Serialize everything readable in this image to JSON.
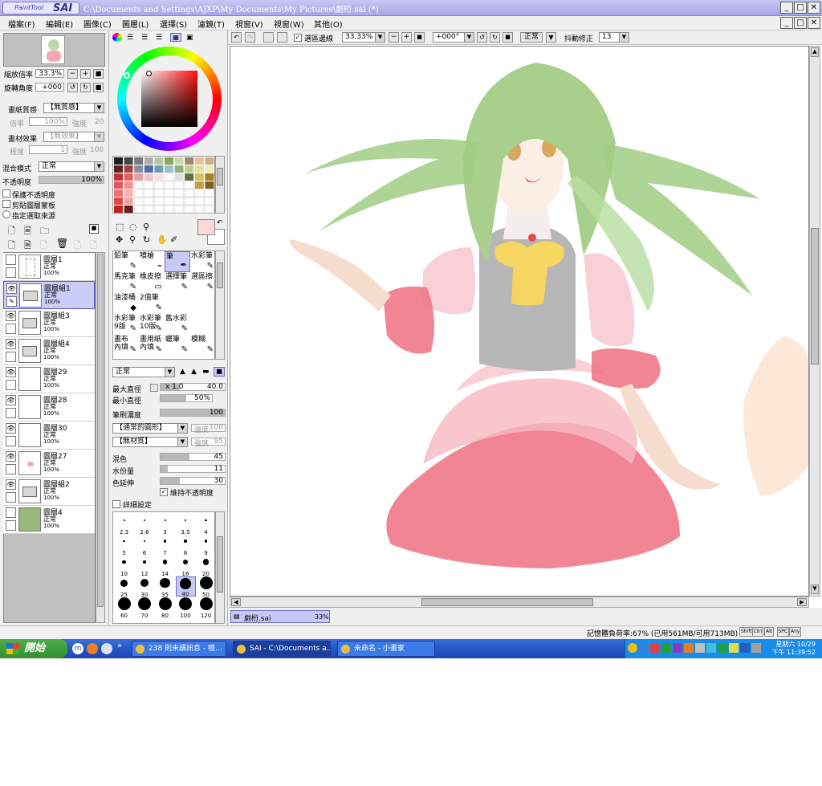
{
  "app": {
    "logo_small": "PaintTool",
    "logo_big": "SAI",
    "title": "C:\\Documents and Settings\\AJXP\\My Documents\\My Pictures\\劇桁.sai (*)",
    "win_min": "_",
    "win_max": "□",
    "win_close": "✕"
  },
  "menu": [
    "檔案(F)",
    "編輯(E)",
    "圖像(C)",
    "圖層(L)",
    "選擇(S)",
    "濾鏡(T)",
    "視窗(V)",
    "視窗(W)",
    "其他(O)"
  ],
  "navigator": {
    "zoom_label": "縮放倍率",
    "zoom_value": "33.3%",
    "rotate_label": "旋轉角度",
    "rotate_value": "+000"
  },
  "layer_props": {
    "paper_texture_label": "畫紙質感",
    "paper_texture_value": "【無質感】",
    "scale_label": "倍率",
    "scale_value": "100%",
    "strength_label": "強度",
    "strength_value": "20",
    "material_label": "畫材效果",
    "material_value": "【無效果】",
    "degree_label": "程度",
    "degree_value": "1",
    "strength2_label": "強度",
    "strength2_value": "100",
    "blend_label": "混合模式",
    "blend_value": "正常",
    "opacity_label": "不透明度",
    "opacity_value": "100%",
    "protect_opacity": "保護不透明度",
    "clip_group": "剪貼圖層蒙板",
    "selection_source": "指定選取來源"
  },
  "layers": [
    {
      "name": "圖層1",
      "mode": "正常",
      "opacity": "100%",
      "visible": false,
      "kind": "sketch"
    },
    {
      "name": "圖層組1",
      "mode": "正常",
      "opacity": "100%",
      "visible": true,
      "kind": "folder",
      "active": true
    },
    {
      "name": "圖層組3",
      "mode": "正常",
      "opacity": "100%",
      "visible": true,
      "kind": "folder"
    },
    {
      "name": "圖層組4",
      "mode": "正常",
      "opacity": "100%",
      "visible": true,
      "kind": "folder"
    },
    {
      "name": "圖層29",
      "mode": "正常",
      "opacity": "100%",
      "visible": true,
      "kind": "blank"
    },
    {
      "name": "圖層28",
      "mode": "正常",
      "opacity": "100%",
      "visible": true,
      "kind": "blank"
    },
    {
      "name": "圖層30",
      "mode": "正常",
      "opacity": "100%",
      "visible": true,
      "kind": "blank"
    },
    {
      "name": "圖層27",
      "mode": "正常",
      "opacity": "100%",
      "visible": true,
      "kind": "pink"
    },
    {
      "name": "圖層組2",
      "mode": "正常",
      "opacity": "100%",
      "visible": true,
      "kind": "folder"
    },
    {
      "name": "圖層4",
      "mode": "正常",
      "opacity": "100%",
      "visible": false,
      "kind": "green"
    }
  ],
  "tools": [
    {
      "label": "鉛筆",
      "icon": "✎"
    },
    {
      "label": "噴槍",
      "icon": "⌁"
    },
    {
      "label": "筆",
      "icon": "✒",
      "active": true
    },
    {
      "label": "水彩筆",
      "icon": "✎"
    },
    {
      "label": "馬克筆",
      "icon": "✎"
    },
    {
      "label": "橡皮擦",
      "icon": "▭"
    },
    {
      "label": "選擇筆",
      "icon": "✎"
    },
    {
      "label": "選區擦",
      "icon": "✎"
    },
    {
      "label": "油漆桶",
      "icon": "◆"
    },
    {
      "label": "2值筆",
      "icon": "✎"
    },
    {
      "label": "",
      "icon": ""
    },
    {
      "label": "",
      "icon": ""
    },
    {
      "label": "水彩筆 9版",
      "icon": "✎"
    },
    {
      "label": "水彩筆 10版",
      "icon": "✎"
    },
    {
      "label": "舊水彩",
      "icon": "✎"
    },
    {
      "label": "",
      "icon": ""
    },
    {
      "label": "畫布 內填",
      "icon": "✎"
    },
    {
      "label": "畫用紙 內填",
      "icon": "✎"
    },
    {
      "label": "蠟筆",
      "icon": "✎"
    },
    {
      "label": "模糊",
      "icon": "✎"
    }
  ],
  "brush": {
    "mode": "正常",
    "max_diam_label": "最大直徑",
    "max_diam_mult": "x 1.0",
    "max_diam_value": "40.0",
    "min_diam_label": "最小直徑",
    "min_diam_value": "50%",
    "density_label": "筆刷濃度",
    "density_value": "100",
    "shape_value": "【通常的圓形】",
    "shape_strength_label": "強度",
    "shape_strength_value": "100",
    "texture_value": "【無材質】",
    "texture_strength_label": "強度",
    "texture_strength_value": "95",
    "blend_label": "混色",
    "blend_value": "45",
    "water_label": "水份量",
    "water_value": "11",
    "color_ext_label": "色延伸",
    "color_ext_value": "30",
    "keep_opacity": "維持不透明度",
    "detail_settings": "詳細設定"
  },
  "brush_sizes": [
    "2.3",
    "2.6",
    "3",
    "3.5",
    "4",
    "5",
    "6",
    "7",
    "8",
    "9",
    "10",
    "12",
    "14",
    "16",
    "20",
    "25",
    "30",
    "35",
    "40",
    "50",
    "60",
    "70",
    "80",
    "100",
    "120"
  ],
  "brush_size_active": "40",
  "canvas_toolbar": {
    "selection_edge": "選區邊線",
    "zoom": "33.33%",
    "rotation": "+000°",
    "mode": "正常",
    "stabilizer_label": "抖動修正",
    "stabilizer_value": "13"
  },
  "doc_tab": {
    "name": "劇桁.sai",
    "zoom": "33%"
  },
  "status": {
    "memory": "記憶體負荷率:67% (已用561MB/可用713MB)",
    "keys": [
      "Shift",
      "Ctrl",
      "Alt",
      "SPC",
      "Any"
    ]
  },
  "taskbar": {
    "start": "開始",
    "tasks": [
      {
        "label": "238 則未讀訊息 - 噫...",
        "active": false
      },
      {
        "label": "SAI - C:\\Documents a...",
        "active": true
      },
      {
        "label": "未命名 - 小畫家",
        "active": false
      }
    ],
    "clock_day": "星期六 10/29",
    "clock_time": "下午 11:39:52"
  },
  "colors": {
    "accent": "#a9a5e8",
    "selection": "#ccccf8",
    "hair": "#a8d08c",
    "skirt": "#f07888",
    "bow": "#f4d660",
    "vest": "#b4b4b4"
  }
}
